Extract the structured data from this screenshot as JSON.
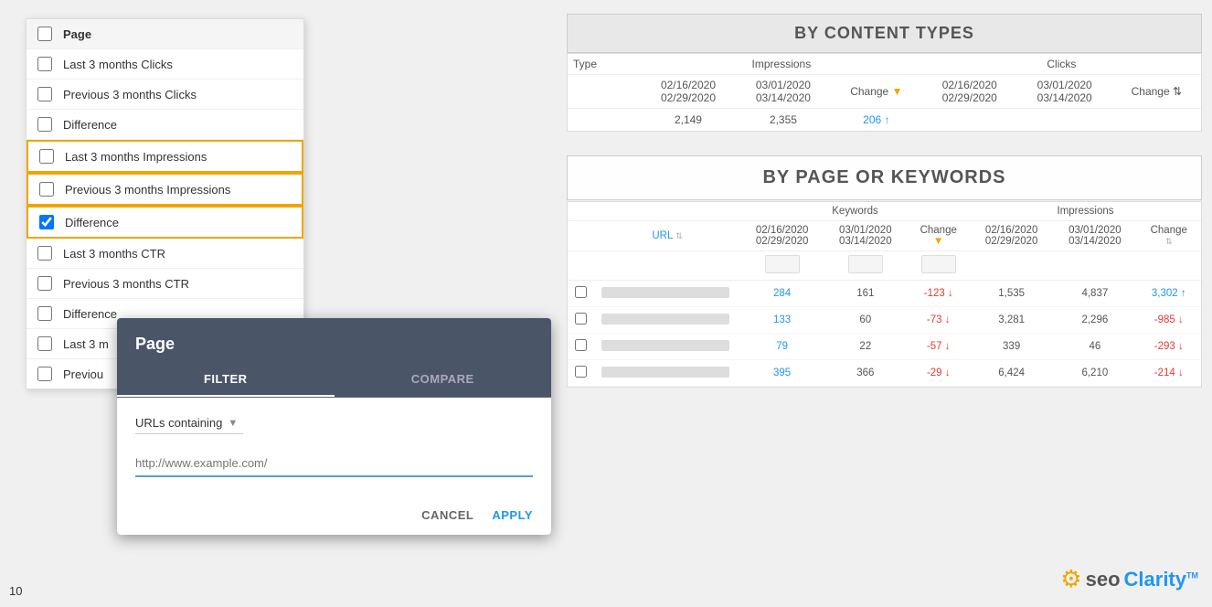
{
  "page": {
    "number": "10"
  },
  "checkboxPanel": {
    "items": [
      {
        "id": "page",
        "label": "Page",
        "checked": false,
        "isHeader": true
      },
      {
        "id": "last3clicks",
        "label": "Last 3 months Clicks",
        "checked": false
      },
      {
        "id": "prev3clicks",
        "label": "Previous 3 months Clicks",
        "checked": false
      },
      {
        "id": "diff1",
        "label": "Difference",
        "checked": false
      },
      {
        "id": "last3impressions",
        "label": "Last 3 months Impressions",
        "checked": false,
        "highlighted": true
      },
      {
        "id": "prev3impressions",
        "label": "Previous 3 months Impressions",
        "checked": false,
        "highlighted": true
      },
      {
        "id": "diff2",
        "label": "Difference",
        "checked": true,
        "highlighted": true
      },
      {
        "id": "last3ctr",
        "label": "Last 3 months CTR",
        "checked": false
      },
      {
        "id": "prev3ctr",
        "label": "Previous 3 months CTR",
        "checked": false,
        "partial": true
      },
      {
        "id": "diff3",
        "label": "Difference",
        "checked": false,
        "partial": true
      },
      {
        "id": "last3x",
        "label": "Last 3 m",
        "checked": false,
        "partial": true
      },
      {
        "id": "prev3x",
        "label": "Previou",
        "checked": false,
        "partial": true
      }
    ]
  },
  "pageModal": {
    "title": "Page",
    "tabs": [
      {
        "id": "filter",
        "label": "FILTER",
        "active": true
      },
      {
        "id": "compare",
        "label": "COMPARE",
        "active": false
      }
    ],
    "filterSelect": {
      "value": "URLs containing",
      "placeholder": "http://www.example.com/"
    },
    "buttons": {
      "cancel": "CANCEL",
      "apply": "APPLY"
    }
  },
  "contentTypesSection": {
    "title": "BY CONTENT TYPES",
    "impressions": {
      "label": "Impressions",
      "date1": "02/16/2020",
      "date2": "03/01/2020",
      "date3": "02/29/2020",
      "date4": "03/14/2020",
      "changeLabel": "Change"
    },
    "clicks": {
      "label": "Clicks",
      "date1": "02/16/2020",
      "date2": "03/01/2020",
      "date3": "02/29/2020",
      "date4": "03/14/2020",
      "changeLabel": "Change"
    },
    "typeLabel": "Type",
    "rows": [
      {
        "type": "",
        "imp1": "2,149",
        "imp2": "2,355",
        "impChange": "206",
        "impChangeDir": "up"
      }
    ]
  },
  "pageKeywordsSection": {
    "title": "BY PAGE OR KEYWORDS",
    "keywords": {
      "label": "Keywords",
      "date1": "02/16/2020",
      "date2": "03/01/2020",
      "date3": "02/29/2020",
      "date4": "03/14/2020",
      "changeLabel": "Change"
    },
    "impressions": {
      "label": "Impressions",
      "date1": "02/16/2020",
      "date2": "03/01/2020",
      "date3": "02/29/2020",
      "date4": "03/14/2020",
      "changeLabel": "Change"
    },
    "urlLabel": "URL",
    "rows": [
      {
        "kw1": "284",
        "kw2": "161",
        "kwChange": "-123",
        "kwChangeDir": "down",
        "imp1": "1,535",
        "imp2": "4,837",
        "impChange": "3,302",
        "impChangeDir": "up"
      },
      {
        "kw1": "133",
        "kw2": "60",
        "kwChange": "-73",
        "kwChangeDir": "down",
        "imp1": "3,281",
        "imp2": "2,296",
        "impChange": "-985",
        "impChangeDir": "down"
      },
      {
        "kw1": "79",
        "kw2": "22",
        "kwChange": "-57",
        "kwChangeDir": "down",
        "imp1": "339",
        "imp2": "46",
        "impChange": "-293",
        "impChangeDir": "down"
      },
      {
        "kw1": "395",
        "kw2": "366",
        "kwChange": "-29",
        "kwChangeDir": "down",
        "imp1": "6,424",
        "imp2": "6,210",
        "impChange": "-214",
        "impChangeDir": "down"
      }
    ]
  },
  "logo": {
    "seo": "seo",
    "clarity": "Clarity",
    "tm": "TM"
  }
}
